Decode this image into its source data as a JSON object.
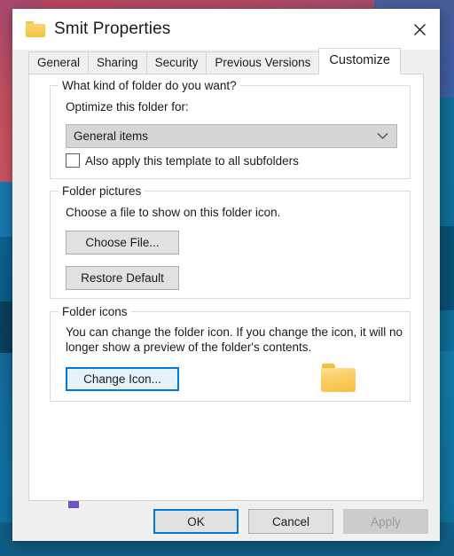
{
  "window": {
    "title": "Smit Properties",
    "folder_icon": "folder-icon",
    "close_icon": "close-icon"
  },
  "tabs": [
    {
      "label": "General",
      "active": false
    },
    {
      "label": "Sharing",
      "active": false
    },
    {
      "label": "Security",
      "active": false
    },
    {
      "label": "Previous Versions",
      "active": false
    },
    {
      "label": "Customize",
      "active": true
    }
  ],
  "groups": {
    "folder_kind": {
      "legend": "What kind of folder do you want?",
      "optimize_label": "Optimize this folder for:",
      "combobox": {
        "value": "General items",
        "chevron_icon": "chevron-down-icon"
      },
      "checkbox": {
        "label": "Also apply this template to all subfolders",
        "checked": false
      }
    },
    "folder_pictures": {
      "legend": "Folder pictures",
      "description": "Choose a file to show on this folder icon.",
      "choose_file_label": "Choose File...",
      "restore_default_label": "Restore Default"
    },
    "folder_icons": {
      "legend": "Folder icons",
      "description_line1": "You can change the folder icon. If you change the icon, it will no",
      "description_line2": "longer show a preview of the folder's contents.",
      "change_icon_label": "Change Icon...",
      "preview_icon": "folder-icon"
    }
  },
  "footer": {
    "ok_label": "OK",
    "cancel_label": "Cancel",
    "apply_label": "Apply",
    "apply_disabled": true
  },
  "annotation": {
    "type": "arrow-up",
    "points_to": "Change Icon...",
    "color": "#6d52c8"
  },
  "colors": {
    "accent_blue": "#0078d7",
    "highlight_fill": "#e5f1fb",
    "dialog_bg": "#f0f0f0",
    "panel_bg": "#ffffff",
    "folder_yellow": "#f8c040",
    "arrow_purple": "#6d52c8"
  }
}
